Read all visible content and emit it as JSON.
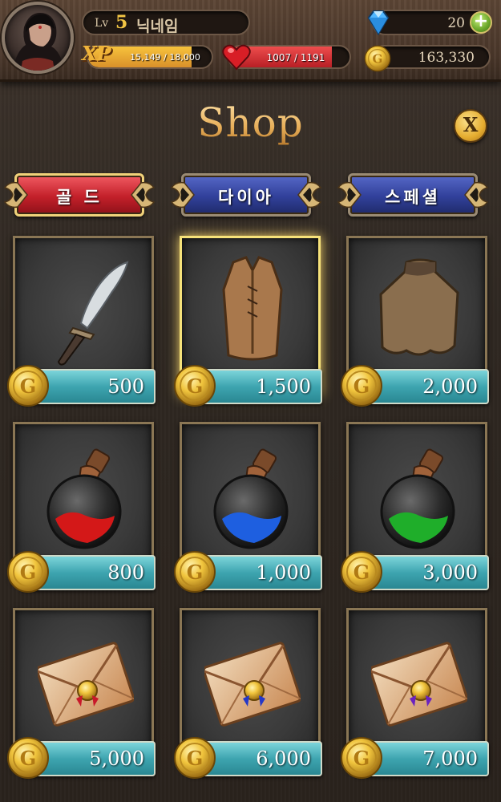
{
  "player": {
    "level_label": "Lv",
    "level": "5",
    "nickname": "닉네임",
    "xp_badge": "XP",
    "xp_text": "15,149 / 18,000",
    "xp_progress": 0.84,
    "hp_text": "1007 / 1191",
    "hp_progress": 0.85,
    "gems": "20",
    "gold": "163,330"
  },
  "shop": {
    "title": "Shop",
    "close_label": "X",
    "tabs": [
      {
        "label": "골 드",
        "active": true
      },
      {
        "label": "다이아",
        "active": false
      },
      {
        "label": "스페셜",
        "active": false
      }
    ],
    "items": [
      {
        "name": "dagger",
        "price": "500"
      },
      {
        "name": "leather-vest",
        "price": "1,500",
        "selected": true
      },
      {
        "name": "cloak",
        "price": "2,000"
      },
      {
        "name": "red-potion",
        "price": "800"
      },
      {
        "name": "blue-potion",
        "price": "1,000"
      },
      {
        "name": "green-potion",
        "price": "3,000"
      },
      {
        "name": "letter-red",
        "price": "5,000"
      },
      {
        "name": "letter-blue",
        "price": "6,000"
      },
      {
        "name": "letter-purple",
        "price": "7,000"
      }
    ]
  },
  "colors": {
    "accent_gold": "#f3c67a",
    "tab_active": "#c3202a",
    "tab_inactive": "#31409a",
    "price_bar": "#3ea5b0",
    "hp": "#d8262e",
    "xp": "#f7c33c"
  },
  "icons": [
    "avatar",
    "xp-icon",
    "heart-icon",
    "diamond-icon",
    "plus-icon",
    "gold-coin-icon",
    "close-icon"
  ]
}
